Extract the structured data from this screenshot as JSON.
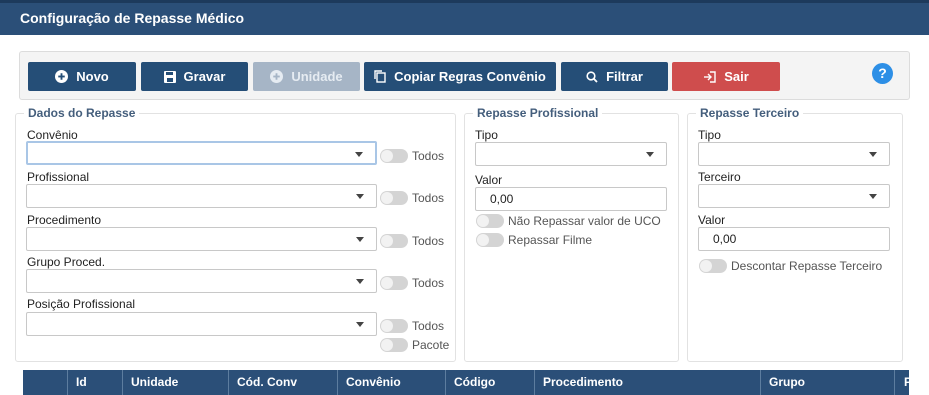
{
  "window": {
    "title": "Configuração de Repasse Médico"
  },
  "toolbar": {
    "novo": "Novo",
    "gravar": "Gravar",
    "unidade": "Unidade",
    "copiar": "Copiar Regras Convênio",
    "filtrar": "Filtrar",
    "sair": "Sair",
    "help": "?"
  },
  "dados_repasse": {
    "legend": "Dados do Repasse",
    "convenio_label": "Convênio",
    "profissional_label": "Profissional",
    "procedimento_label": "Procedimento",
    "grupo_label": "Grupo Proced.",
    "posicao_label": "Posição Profissional",
    "todos": "Todos",
    "pacote": "Pacote"
  },
  "repasse_profissional": {
    "legend": "Repasse Profissional",
    "tipo_label": "Tipo",
    "valor_label": "Valor",
    "valor": "0,00",
    "nao_repassar_uco": "Não Repassar valor de UCO",
    "repassar_filme": "Repassar Filme"
  },
  "repasse_terceiro": {
    "legend": "Repasse Terceiro",
    "tipo_label": "Tipo",
    "terceiro_label": "Terceiro",
    "valor_label": "Valor",
    "valor": "0,00",
    "descontar": "Descontar Repasse Terceiro"
  },
  "table": {
    "columns": [
      "",
      "Id",
      "Unidade",
      "Cód. Conv",
      "Convênio",
      "Código",
      "Procedimento",
      "Grupo",
      "P"
    ]
  },
  "colors": {
    "header": "#2b4f78",
    "button": "#254e77",
    "disabled": "#a6b5c6",
    "exit": "#cf4d4d",
    "help": "#2d8fe6"
  }
}
